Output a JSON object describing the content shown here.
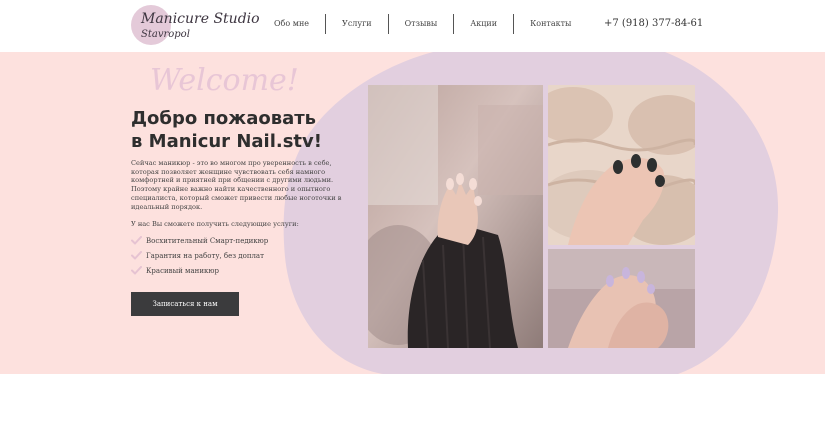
{
  "header": {
    "logo": {
      "line1": "Manicure Studio",
      "line2": "Stavropol"
    },
    "nav": [
      {
        "label": "Обо мне"
      },
      {
        "label": "Услуги"
      },
      {
        "label": "Отзывы"
      },
      {
        "label": "Акции"
      },
      {
        "label": "Контакты"
      }
    ],
    "phone": "+7 (918) 377-84-61"
  },
  "hero": {
    "welcome": "Welcome!",
    "title_line1": "Добро пожаовать",
    "title_line2": "в Manicur Nail.stv!",
    "description": "Сейчас маникюр - это во многом про уверенность в себе, которая позволяет женщине чувствовать себя намного комфортней и приятней при общении с другими людьми. Поэтому крайне важно найти качественного и опытного специалиста, который сможет привести любые ноготочки в идеальный порядок.",
    "services_intro": "У нас Вы сможете получить следующие услуги:",
    "services": [
      {
        "label": "Восхитительный Смарт-педикюр"
      },
      {
        "label": "Гарантия на работу, без доплат"
      },
      {
        "label": "Красивый маникюр"
      }
    ],
    "cta_label": "Записаться к нам"
  },
  "colors": {
    "hero_background": "#fde1de",
    "blob": "#e2cfdf",
    "welcome_script": "#e8c6d6",
    "button": "#3b3b3d",
    "check": "#e6c3d2"
  },
  "images": [
    {
      "icon": "photo-hand-black-sweater-manicure"
    },
    {
      "icon": "photo-hand-black-nails-knit-blanket"
    },
    {
      "icon": "photo-hands-lilac-nails"
    }
  ]
}
